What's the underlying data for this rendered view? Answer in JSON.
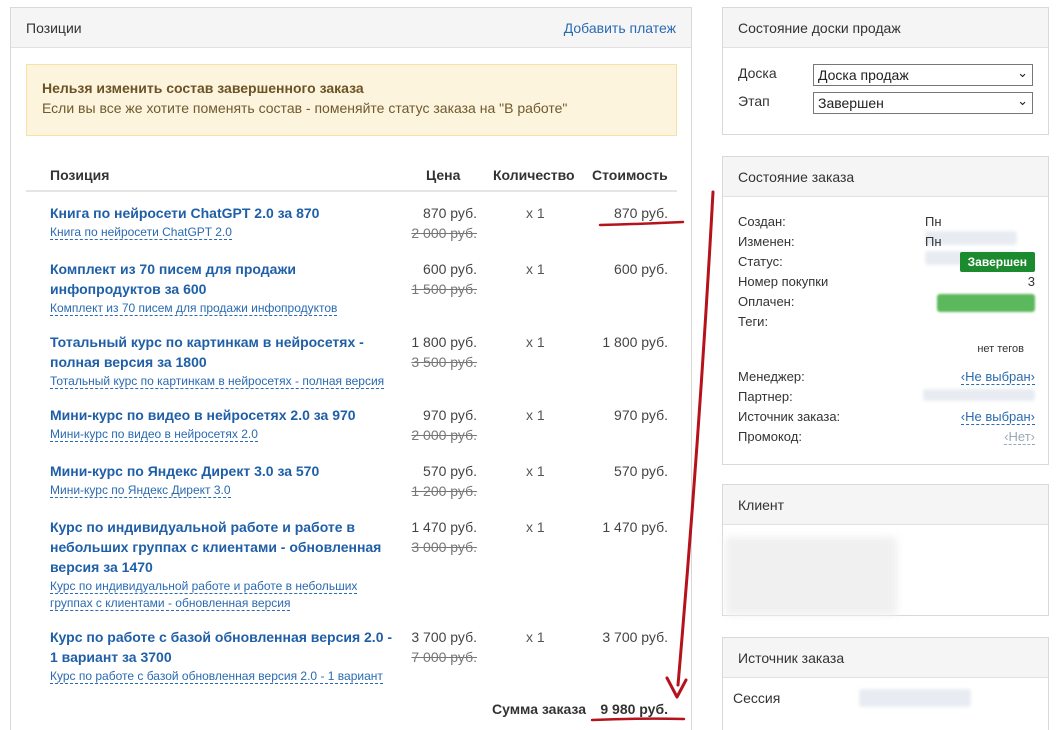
{
  "positions": {
    "title": "Позиции",
    "add_payment": "Добавить платеж",
    "alert_title": "Нельзя изменить состав завершенного заказа",
    "alert_text": "Если вы все же хотите поменять состав - поменяйте статус заказа на \"В работе\"",
    "columns": [
      "Позиция",
      "Цена",
      "Количество",
      "Стоимость"
    ],
    "items": [
      {
        "name": "Книга по нейросети ChatGPT 2.0 за 870",
        "sub": "Книга по нейросети ChatGPT 2.0",
        "price": "870 руб.",
        "old": "2 000 руб.",
        "qty": "x 1",
        "cost": "870 руб."
      },
      {
        "name": "Комплект из 70 писем для продажи инфопродуктов за 600",
        "sub": "Комплект из 70 писем для продажи инфопродуктов",
        "price": "600 руб.",
        "old": "1 500 руб.",
        "qty": "x 1",
        "cost": "600 руб."
      },
      {
        "name": "Тотальный курс по картинкам в нейросетях - полная версия за 1800",
        "sub": "Тотальный курс по картинкам в нейросетях - полная версия",
        "price": "1 800 руб.",
        "old": "3 500 руб.",
        "qty": "x 1",
        "cost": "1 800 руб."
      },
      {
        "name": "Мини-курс по видео в нейросетях 2.0 за 970",
        "sub": "Мини-курс по видео в нейросетях 2.0",
        "price": "970 руб.",
        "old": "2 000 руб.",
        "qty": "x 1",
        "cost": "970 руб."
      },
      {
        "name": "Мини-курс по Яндекс Директ 3.0 за 570",
        "sub": "Мини-курс по Яндекс Директ 3.0",
        "price": "570 руб.",
        "old": "1 200 руб.",
        "qty": "x 1",
        "cost": "570 руб."
      },
      {
        "name": "Курс по индивидуальной работе и работе в небольших группах с клиентами - обновленная версия за 1470",
        "sub": "Курс по индивидуальной работе и работе в небольших группах с клиентами - обновленная версия",
        "price": "1 470 руб.",
        "old": "3 000 руб.",
        "qty": "x 1",
        "cost": "1 470 руб."
      },
      {
        "name": "Курс по работе с базой обновленная версия 2.0 - 1 вариант за 3700",
        "sub": "Курс по работе с базой обновленная версия 2.0 - 1 вариант",
        "price": "3 700 руб.",
        "old": "7 000 руб.",
        "qty": "x 1",
        "cost": "3 700 руб."
      }
    ],
    "total_label": "Сумма заказа",
    "total_value": "9 980 руб."
  },
  "board": {
    "title": "Состояние доски продаж",
    "board_label": "Доска",
    "board_value": "Доска продаж",
    "stage_label": "Этап",
    "stage_value": "Завершен"
  },
  "order": {
    "title": "Состояние заказа",
    "created_label": "Создан:",
    "created_value": "Пн",
    "changed_label": "Изменен:",
    "changed_value": "Пн",
    "status_label": "Статус:",
    "status_value": "Завершен",
    "purchase_no_label": "Номер покупки",
    "purchase_no_value": "3",
    "paid_label": "Оплачен:",
    "tags_label": "Теги:",
    "no_tags": "нет тегов",
    "manager_label": "Менеджер:",
    "manager_value": "‹Не выбран›",
    "partner_label": "Партнер:",
    "source_label": "Источник заказа:",
    "source_value": "‹Не выбран›",
    "promo_label": "Промокод:",
    "promo_value": "‹Нет›"
  },
  "client": {
    "title": "Клиент"
  },
  "source": {
    "title": "Источник заказа",
    "session_label": "Сессия"
  },
  "colors": {
    "link": "#2a6ab1",
    "status_green": "#1c8a2e",
    "annotation_red": "#b5121b"
  }
}
